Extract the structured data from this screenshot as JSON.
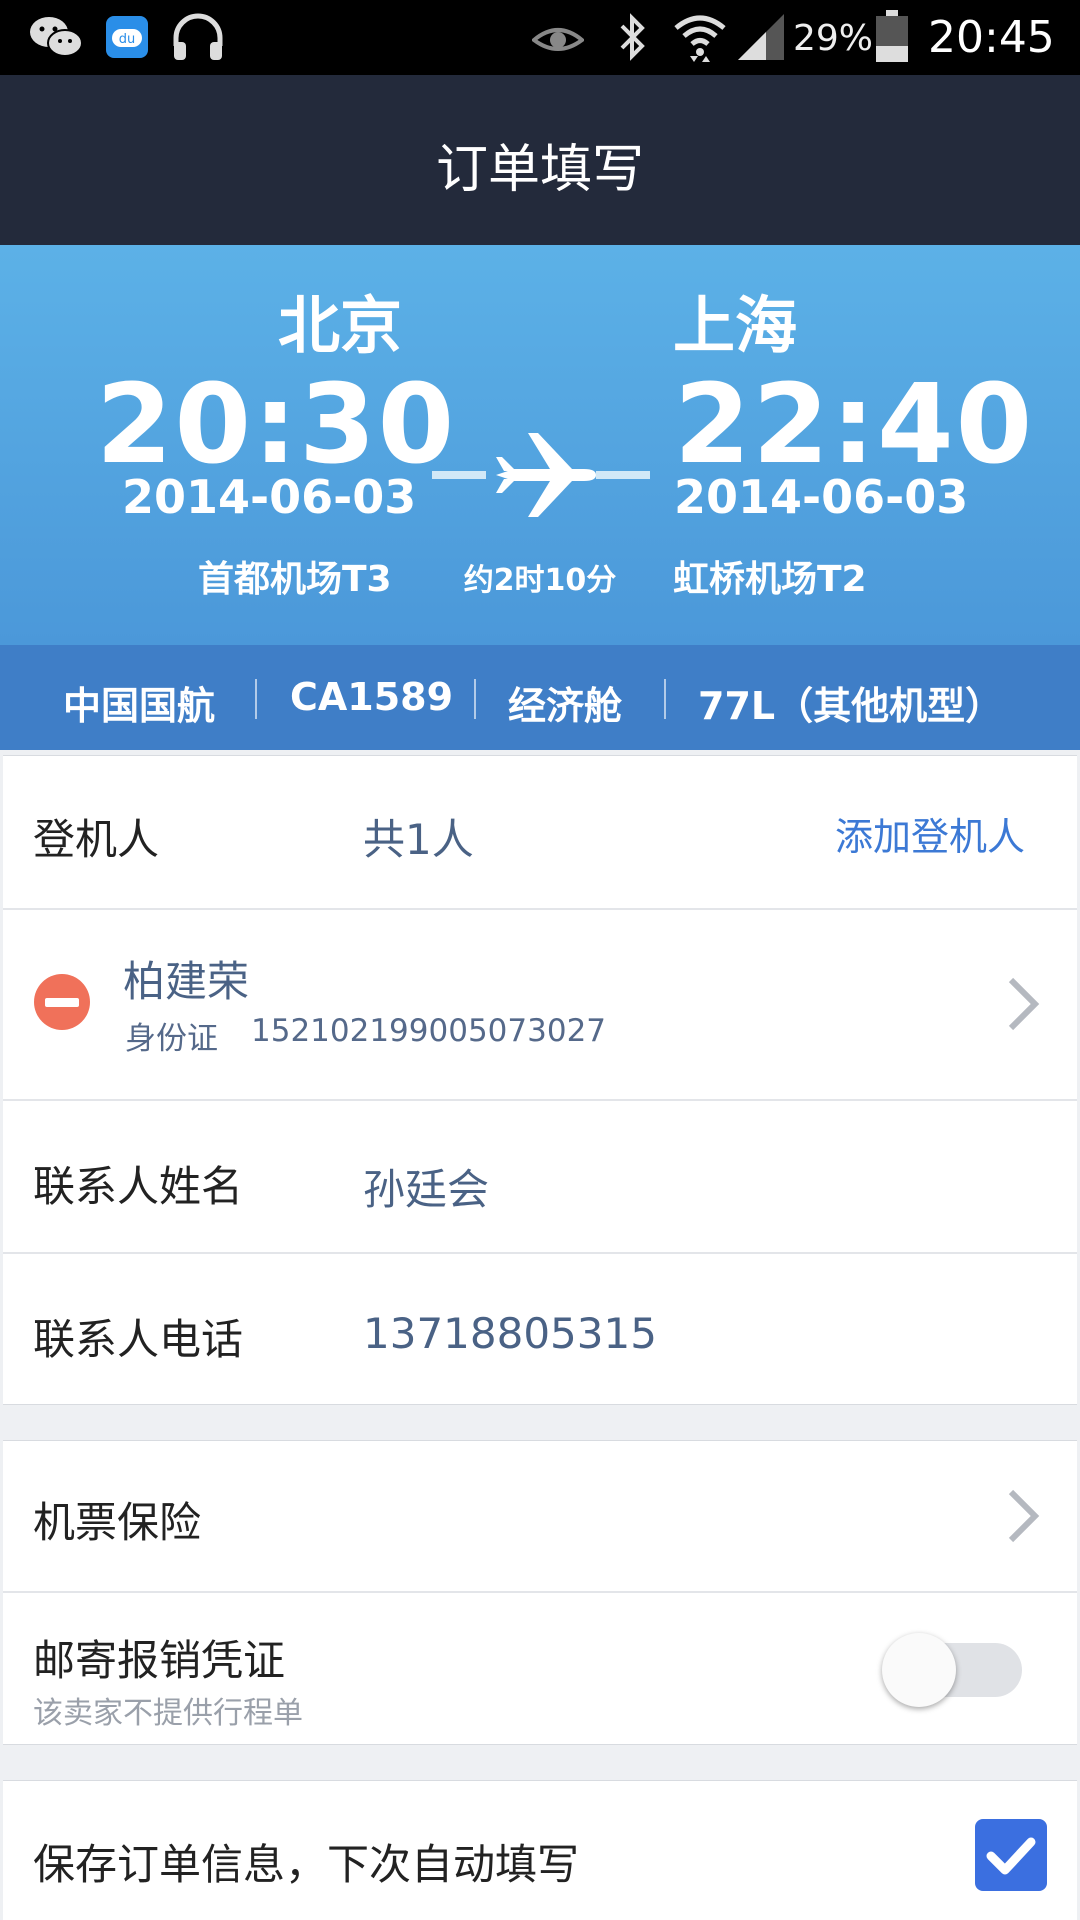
{
  "status_bar": {
    "battery_percent": "29%",
    "time": "20:45",
    "icons": [
      "wechat-icon",
      "baidu-app-icon",
      "headphones-icon",
      "eye-icon",
      "bluetooth-icon",
      "wifi-icon",
      "signal-icon",
      "battery-icon"
    ]
  },
  "header": {
    "title": "订单填写"
  },
  "flight": {
    "departure": {
      "city": "北京",
      "time": "20:30",
      "date": "2014-06-03",
      "airport": "首都机场T3"
    },
    "arrival": {
      "city": "上海",
      "time": "22:40",
      "date": "2014-06-03",
      "airport": "虹桥机场T2"
    },
    "duration": "约2时10分"
  },
  "flight_info": {
    "airline": "中国国航",
    "flight_no": "CA1589",
    "cabin": "经济舱",
    "aircraft": "77L（其他机型）"
  },
  "passengers": {
    "label": "登机人",
    "count": "共1人",
    "add_label": "添加登机人",
    "items": [
      {
        "name": "柏建荣",
        "id_type": "身份证",
        "id_number": "152102199005073027"
      }
    ]
  },
  "contact": {
    "name_label": "联系人姓名",
    "name_value": "孙廷会",
    "phone_label": "联系人电话",
    "phone_value": "13718805315"
  },
  "extras": {
    "insurance_label": "机票保险",
    "receipt_label": "邮寄报销凭证",
    "receipt_hint": "该卖家不提供行程单",
    "receipt_enabled": false
  },
  "save": {
    "label": "保存订单信息，下次自动填写",
    "checked": true
  },
  "colors": {
    "title_bar": "#232a3b",
    "flight_gradient_top": "#5cb1e7",
    "info_bar": "#3f7ec7",
    "link": "#3c79d5",
    "remove_icon": "#f0715a",
    "checkbox": "#3b6fe0"
  }
}
